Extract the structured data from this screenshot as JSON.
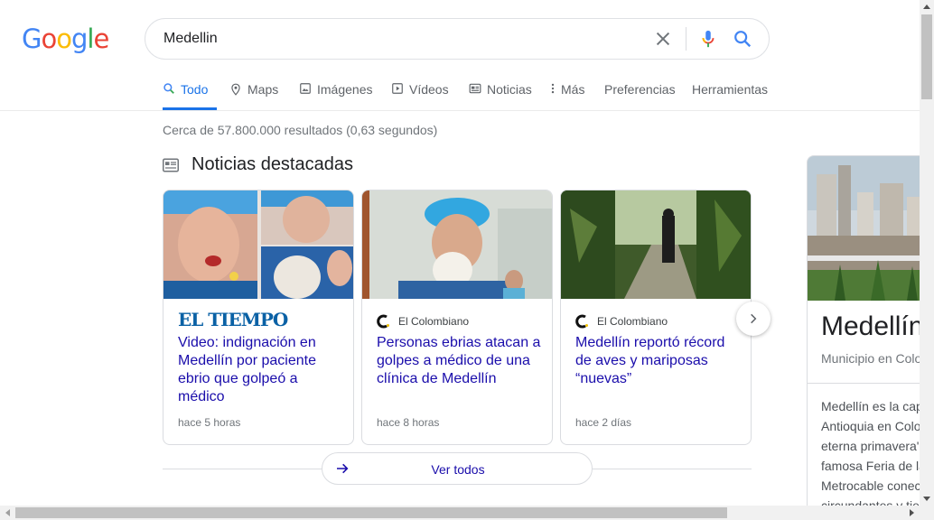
{
  "logo": {
    "letters": [
      "G",
      "o",
      "o",
      "g",
      "l",
      "e"
    ]
  },
  "search": {
    "query": "Medellin"
  },
  "tabs": [
    {
      "label": "Todo",
      "icon": "search-icon"
    },
    {
      "label": "Maps",
      "icon": "map-pin-icon"
    },
    {
      "label": "Imágenes",
      "icon": "image-icon"
    },
    {
      "label": "Vídeos",
      "icon": "video-icon"
    },
    {
      "label": "Noticias",
      "icon": "news-icon"
    },
    {
      "label": "Más",
      "icon": "more-vertical-icon"
    },
    {
      "label": "Preferencias"
    },
    {
      "label": "Herramientas"
    }
  ],
  "result_stats": "Cerca de 57.800.000 resultados (0,63 segundos)",
  "news": {
    "heading": "Noticias destacadas",
    "cards": [
      {
        "source": "EL TIEMPO",
        "title": "Video: indignación en Medellín por paciente ebrio que golpeó a médico",
        "time": "hace 5 horas"
      },
      {
        "source": "El Colombiano",
        "title": "Personas ebrias atacan a golpes a médico de una clínica de Medellín",
        "time": "hace 8 horas"
      },
      {
        "source": "El Colombiano",
        "title": "Medellín reportó récord de aves y mariposas “nuevas”",
        "time": "hace 2 días"
      }
    ],
    "see_all": "Ver todos"
  },
  "knowledge_panel": {
    "name": "Medellín",
    "subtitle": "Municipio en Colombia",
    "description_lines": [
      "Medellín es la capital",
      "Antioquia en Colombia.",
      "eterna primavera\" por su",
      "famosa Feria de las Flores",
      "Metrocable conecta",
      "circundantes y tiene"
    ]
  },
  "colors": {
    "link": "#1a0dab",
    "accent": "#1a73e8",
    "eltiempo": "#0a61a5"
  }
}
